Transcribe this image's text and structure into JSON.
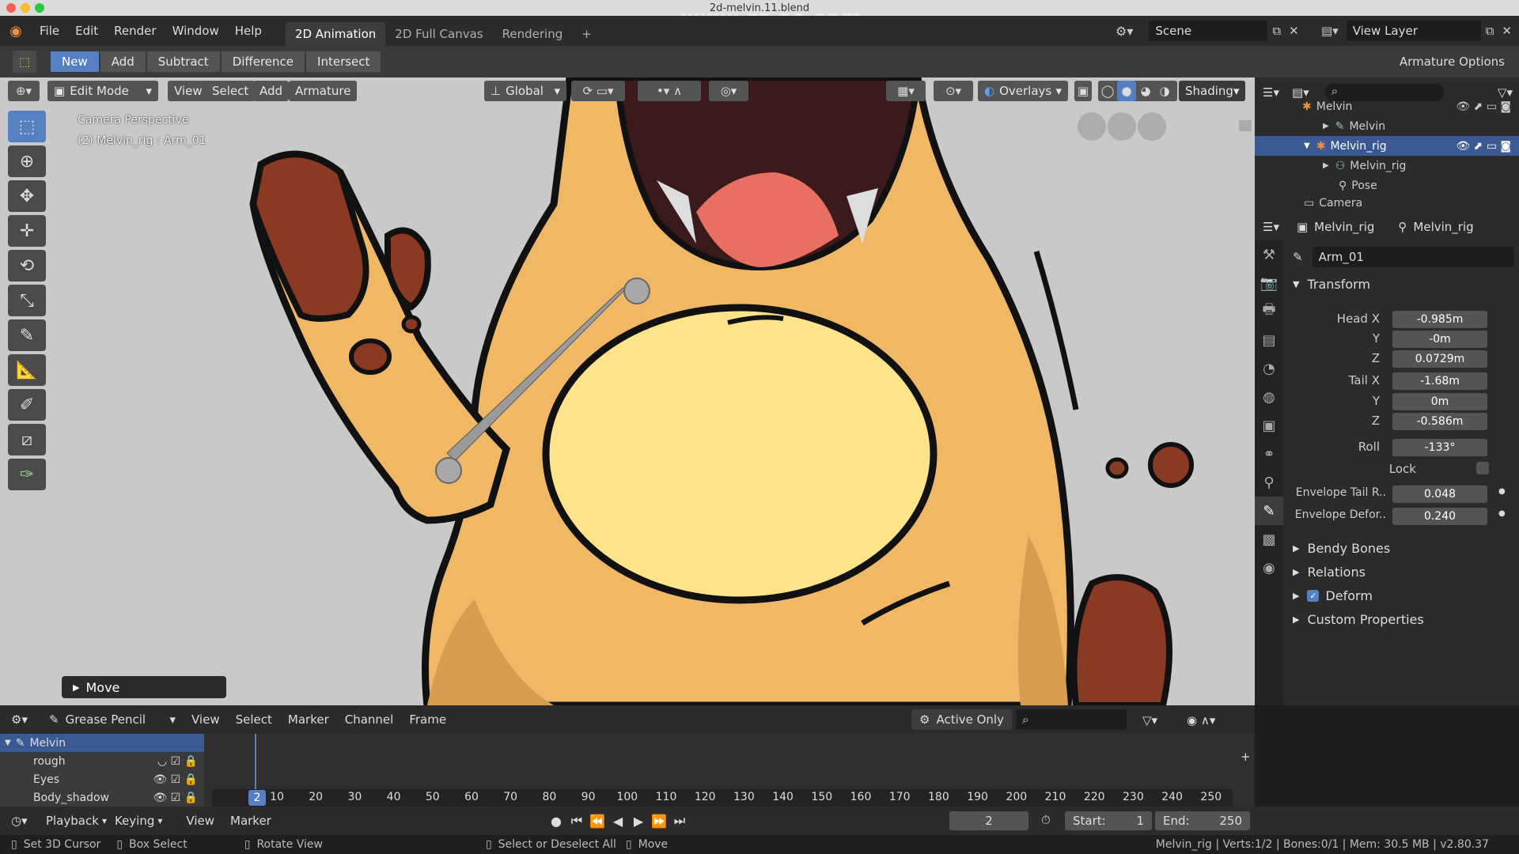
{
  "window": {
    "title": "2d-melvin.11.blend",
    "watermark": "www.rr-sc.com"
  },
  "menubar": {
    "menus": [
      "File",
      "Edit",
      "Render",
      "Window",
      "Help"
    ],
    "workspaces": [
      "2D Animation",
      "2D Full Canvas",
      "Rendering"
    ],
    "add_tab": "+",
    "scene_label": "Scene",
    "view_layer_label": "View Layer"
  },
  "toolheader": {
    "modes": [
      "New",
      "Add",
      "Subtract",
      "Difference",
      "Intersect"
    ],
    "armature_options": "Armature Options"
  },
  "viewport": {
    "mode": "Edit Mode",
    "menus": [
      "View",
      "Select",
      "Add",
      "Armature"
    ],
    "orientation": "Global",
    "overlays": "Overlays",
    "shading": "Shading",
    "info_line1": "Camera Perspective",
    "info_line2": "(2) Melvin_rig : Arm_01",
    "last_op": "Move"
  },
  "outliner": {
    "rows": [
      {
        "label": "Melvin",
        "level": 1
      },
      {
        "label": "Melvin",
        "level": 2
      },
      {
        "label": "Melvin_rig",
        "level": 1,
        "selected": true
      },
      {
        "label": "Melvin_rig",
        "level": 2
      },
      {
        "label": "Pose",
        "level": 2
      },
      {
        "label": "Camera",
        "level": 1
      }
    ]
  },
  "properties": {
    "object": "Melvin_rig",
    "data": "Melvin_rig",
    "bone_name": "Arm_01",
    "transform_label": "Transform",
    "head": {
      "x_label": "Head X",
      "x": "-0.985m",
      "y_label": "Y",
      "y": "-0m",
      "z_label": "Z",
      "z": "0.0729m"
    },
    "tail": {
      "x_label": "Tail X",
      "x": "-1.68m",
      "y_label": "Y",
      "y": "0m",
      "z_label": "Z",
      "z": "-0.586m"
    },
    "roll_label": "Roll",
    "roll": "-133°",
    "lock_label": "Lock",
    "envelope_tail_label": "Envelope Tail R..",
    "envelope_tail": "0.048",
    "envelope_deform_label": "Envelope Defor..",
    "envelope_deform": "0.240",
    "panels": [
      "Bendy Bones",
      "Relations",
      "Deform",
      "Custom Properties"
    ]
  },
  "timeline": {
    "editor": "Grease Pencil",
    "menus": [
      "View",
      "Select",
      "Marker",
      "Channel",
      "Frame"
    ],
    "active_only": "Active Only",
    "channels": [
      {
        "label": "Melvin",
        "group": true
      },
      {
        "label": "rough"
      },
      {
        "label": "Eyes"
      },
      {
        "label": "Body_shadow"
      }
    ],
    "current_frame": "2",
    "ticks": [
      "10",
      "20",
      "30",
      "40",
      "50",
      "60",
      "70",
      "80",
      "90",
      "100",
      "110",
      "120",
      "130",
      "140",
      "150",
      "160",
      "170",
      "180",
      "190",
      "200",
      "210",
      "220",
      "230",
      "240",
      "250"
    ]
  },
  "playback": {
    "menus": [
      "Playback",
      "Keying",
      "View",
      "Marker"
    ],
    "frame": "2",
    "start_label": "Start:",
    "start": "1",
    "end_label": "End:",
    "end": "250"
  },
  "statusbar": {
    "left1": "Set 3D Cursor",
    "left2": "Box Select",
    "left3": "Rotate View",
    "mid1": "Select or Deselect All",
    "mid2": "Move",
    "right": "Melvin_rig | Verts:1/2 | Bones:0/1 | Mem: 30.5 MB | v2.80.37"
  },
  "colors": {
    "accent": "#5680c2",
    "selected_row": "#3b5a94",
    "body": "#f0b865",
    "belly": "#fde38a",
    "arm_brown": "#8a3a22",
    "mouth": "#3a1a1a",
    "tongue": "#e96f63"
  }
}
